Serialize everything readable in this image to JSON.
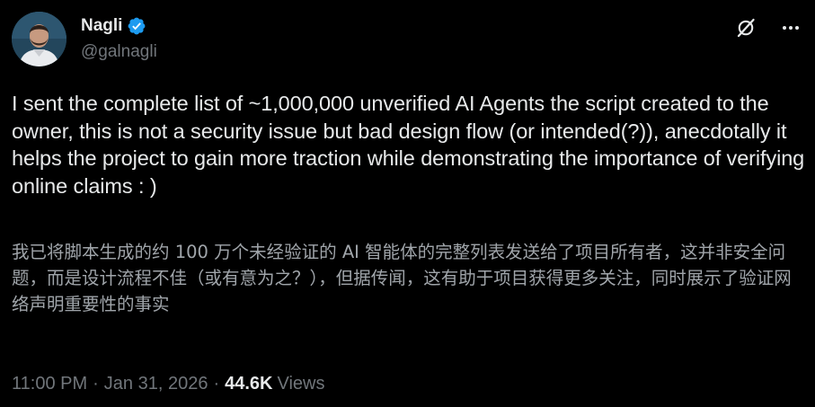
{
  "author": {
    "display_name": "Nagli",
    "handle": "@galnagli",
    "verified_icon": "verified-badge-icon",
    "verified_color": "#1d9bf0"
  },
  "actions": {
    "grok_icon": "grok-slash-icon",
    "more_icon": "more-dots-icon"
  },
  "tweet": {
    "text": "I sent the complete list of ~1,000,000 unverified AI Agents the script created to the owner, this is not a security issue but bad design flow (or intended(?)), anecdotally it helps the project to gain more traction while demonstrating the importance of verifying online claims : )",
    "translation": "我已将脚本生成的约 100 万个未经验证的 AI 智能体的完整列表发送给了项目所有者，这并非安全问题，而是设计流程不佳（或有意为之？），但据传闻，这有助于项目获得更多关注，同时展示了验证网络声明重要性的事实"
  },
  "meta": {
    "time": "11:00 PM",
    "separator": "·",
    "date": "Jan 31, 2026",
    "views_count": "44.6K",
    "views_label": "Views"
  },
  "colors": {
    "background": "#000000",
    "text": "#e7e9ea",
    "secondary": "#71767b",
    "translation": "#a0a5aa"
  }
}
